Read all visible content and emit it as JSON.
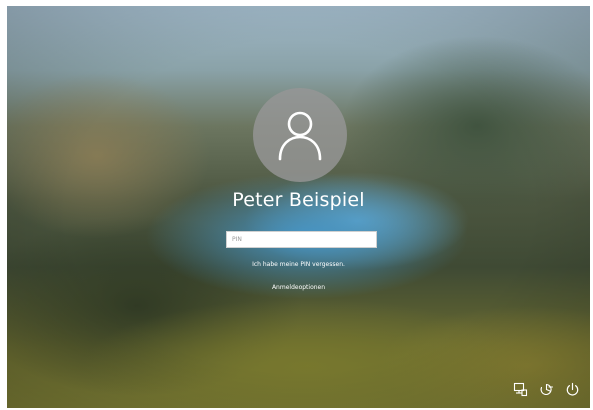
{
  "lock_screen": {
    "user": {
      "avatar_icon": "user-silhouette-icon",
      "name": "Peter Beispiel"
    },
    "pin_input": {
      "placeholder": "PIN",
      "value": ""
    },
    "links": {
      "forgot_pin": "Ich habe meine PIN vergessen.",
      "sign_in_options": "Anmeldeoptionen"
    },
    "tray_icons": [
      "network-icon",
      "ease-of-access-icon",
      "power-icon"
    ],
    "colors": {
      "text": "#ffffff",
      "avatar_bg": "#969696",
      "input_bg": "#ffffff"
    }
  }
}
